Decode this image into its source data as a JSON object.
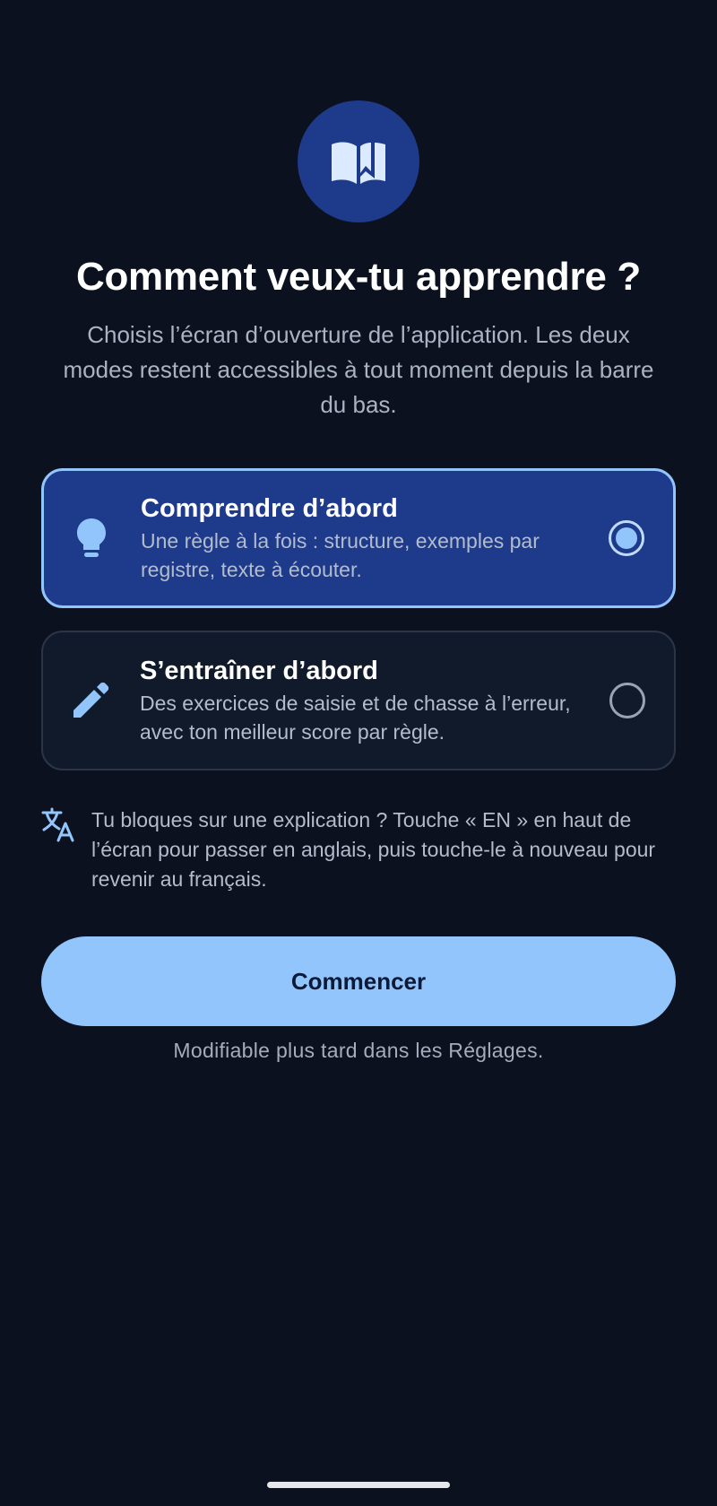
{
  "header": {
    "icon": "book-open-icon",
    "title": "Comment veux-tu apprendre ?",
    "subtitle": "Choisis l’écran d’ouverture de l’application. Les deux modes restent accessibles à tout moment depuis la barre du bas."
  },
  "options": [
    {
      "icon": "lightbulb-icon",
      "title": "Comprendre d’abord",
      "description": "Une règle à la fois : structure, exemples par registre, texte à écouter.",
      "selected": true
    },
    {
      "icon": "pencil-icon",
      "title": "S’entraîner d’abord",
      "description": "Des exercices de saisie et de chasse à l’erreur, avec ton meilleur score par règle.",
      "selected": false
    }
  ],
  "hint": {
    "icon": "translate-icon",
    "text": "Tu bloques sur une explication ? Touche « EN » en haut de l’écran pour passer en anglais, puis touche-le à nouveau pour revenir au français."
  },
  "cta": {
    "label": "Commencer"
  },
  "footnote": "Modifiable plus tard dans les Réglages.",
  "colors": {
    "background": "#0b111e",
    "accent": "#93c5fd",
    "selected_card": "#1e3a8a",
    "card": "#111a2b"
  }
}
